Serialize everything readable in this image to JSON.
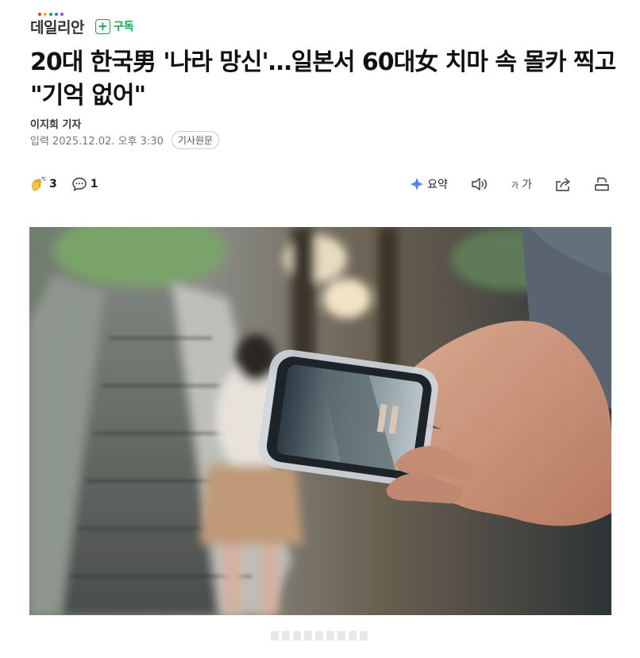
{
  "publisher": {
    "logo_text": "데일리안",
    "subscribe_label": "구독",
    "subscribe_icon": "plus-icon",
    "accent_color": "#1aa34a"
  },
  "article": {
    "title": "20대 한국男 '나라 망신'…일본서 60대女 치마 속 몰카 찍고 \"기억 없어\"",
    "author": "이지희 기자",
    "published_label": "입력",
    "published_date": "2025.12.02. 오후 3:30",
    "original_button": "기사원문"
  },
  "toolbar": {
    "like_icon": "clap-icon",
    "like_count": "3",
    "comment_icon": "comment-icon",
    "comment_count": "1",
    "summary_icon": "ai-sparkle-icon",
    "summary_label": "요약",
    "tts_icon": "speaker-icon",
    "font_small": "가",
    "font_large": "가",
    "share_icon": "share-icon",
    "print_icon": "print-icon"
  },
  "photo": {
    "subject": "hand holding smartphone filming up escalator"
  }
}
